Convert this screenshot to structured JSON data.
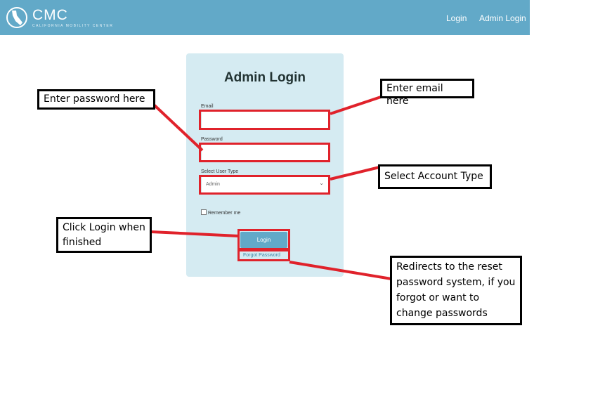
{
  "navbar": {
    "logo_text": "CMC",
    "logo_subtitle": "CALIFORNIA MOBILITY CENTER",
    "links": [
      "Login",
      "Admin Login"
    ]
  },
  "form": {
    "title": "Admin Login",
    "email_label": "Email",
    "email_value": "",
    "password_label": "Password",
    "password_value": "",
    "user_type_label": "Select User Type",
    "user_type_value": "Admin",
    "remember_label": "Remember me",
    "login_button": "Login",
    "forgot_link": "Forgot Password"
  },
  "annotations": {
    "password": "Enter password here",
    "email": "Enter email here",
    "account_type": "Select Account Type",
    "login": "Click Login when finished",
    "forgot": "Redirects to the reset password system, if you forgot or want to change passwords"
  },
  "colors": {
    "navbar": "#62a9c8",
    "card": "#d5ebf2",
    "annotation_red": "#e0222b"
  }
}
